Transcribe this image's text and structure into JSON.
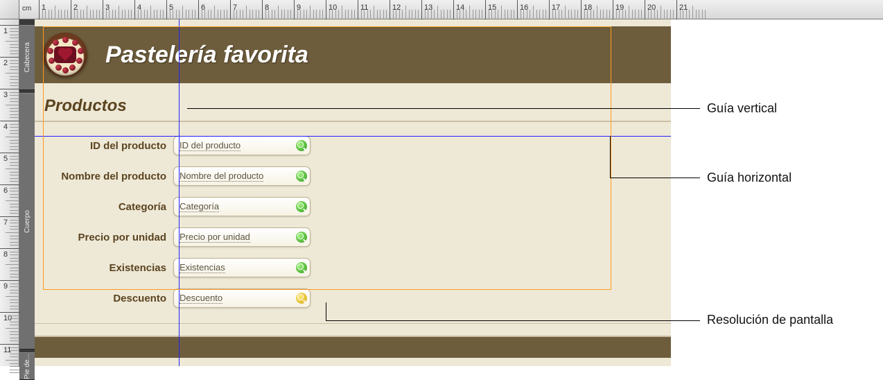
{
  "ruler": {
    "unit_label": "cm"
  },
  "sections": {
    "cabecera": "Cabecera",
    "cuerpo": "Cuerpo",
    "pie": "Pie de..."
  },
  "header": {
    "title": "Pastelería favorita"
  },
  "subheader": {
    "title": "Productos"
  },
  "fields": [
    {
      "label": "ID del producto",
      "placeholder": "ID del producto",
      "lookup": "green"
    },
    {
      "label": "Nombre del producto",
      "placeholder": "Nombre del producto",
      "lookup": "green"
    },
    {
      "label": "Categoría",
      "placeholder": "Categoría",
      "lookup": "green"
    },
    {
      "label": "Precio por unidad",
      "placeholder": "Precio por unidad",
      "lookup": "green"
    },
    {
      "label": "Existencias",
      "placeholder": "Existencias",
      "lookup": "green"
    },
    {
      "label": "Descuento",
      "placeholder": "Descuento",
      "lookup": "yellow"
    }
  ],
  "callouts": {
    "guia_vertical": "Guía vertical",
    "guia_horizontal": "Guía horizontal",
    "resolucion": "Resolución de pantalla"
  }
}
